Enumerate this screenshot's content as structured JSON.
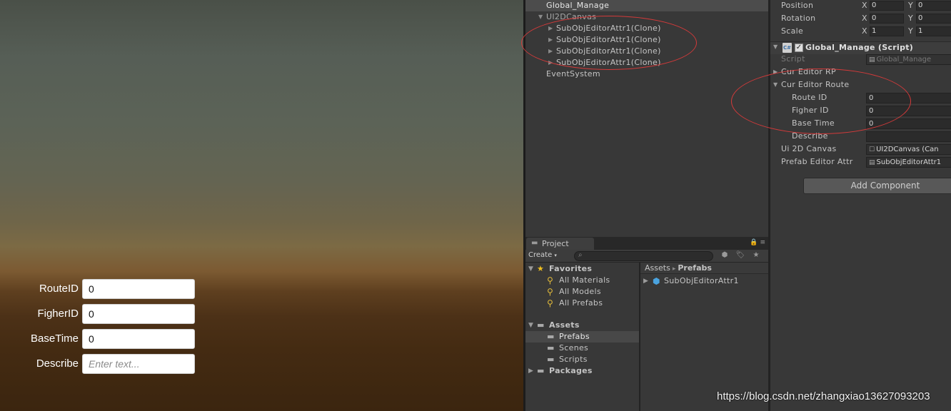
{
  "game_form": {
    "rows": [
      {
        "label": "RouteID",
        "value": "0"
      },
      {
        "label": "FigherID",
        "value": "0"
      },
      {
        "label": "BaseTime",
        "value": "0"
      },
      {
        "label": "Describe",
        "placeholder": "Enter text..."
      }
    ]
  },
  "hierarchy": {
    "items": [
      {
        "label": "Global_Manage"
      },
      {
        "label": "UI2DCanvas"
      },
      {
        "label": "SubObjEditorAttr1(Clone)"
      },
      {
        "label": "SubObjEditorAttr1(Clone)"
      },
      {
        "label": "SubObjEditorAttr1(Clone)"
      },
      {
        "label": "SubObjEditorAttr1(Clone)"
      },
      {
        "label": "EventSystem"
      }
    ]
  },
  "project": {
    "tab_label": "Project",
    "create_label": "Create",
    "favorites": {
      "label": "Favorites",
      "items": [
        "All Materials",
        "All Models",
        "All Prefabs"
      ]
    },
    "assets": {
      "label": "Assets",
      "items": [
        "Prefabs",
        "Scenes",
        "Scripts"
      ]
    },
    "packages_label": "Packages",
    "breadcrumb": {
      "root": "Assets",
      "separator": "▸",
      "current": "Prefabs"
    },
    "asset_items": [
      "SubObjEditorAttr1"
    ]
  },
  "inspector": {
    "transform": [
      {
        "label": "Position",
        "x_label": "X",
        "x": "0",
        "y_label": "Y",
        "y": "0"
      },
      {
        "label": "Rotation",
        "x_label": "X",
        "x": "0",
        "y_label": "Y",
        "y": "0"
      },
      {
        "label": "Scale",
        "x_label": "X",
        "x": "1",
        "y_label": "Y",
        "y": "1"
      }
    ],
    "component_title": "Global_Manage (Script)",
    "component_icon_text": "C#",
    "script_label": "Script",
    "script_value": "Global_Manage",
    "cur_editor_rp_label": "Cur Editor RP",
    "cur_editor_route_label": "Cur Editor Route",
    "route_fields": [
      {
        "label": "Route ID",
        "value": "0"
      },
      {
        "label": "Figher ID",
        "value": "0"
      },
      {
        "label": "Base Time",
        "value": "0"
      },
      {
        "label": "Describe",
        "value": ""
      }
    ],
    "ui2d_canvas_label": "Ui 2D Canvas",
    "ui2d_canvas_value": "UI2DCanvas (Can",
    "prefab_editor_label": "Prefab Editor Attr",
    "prefab_editor_value": "SubObjEditorAttr1",
    "add_component_label": "Add Component"
  },
  "watermark": "https://blog.csdn.net/zhangxiao13627093203",
  "colors": {
    "annotation": "#d43a3a",
    "selection": "#4c4c4c",
    "panel": "#383838"
  }
}
